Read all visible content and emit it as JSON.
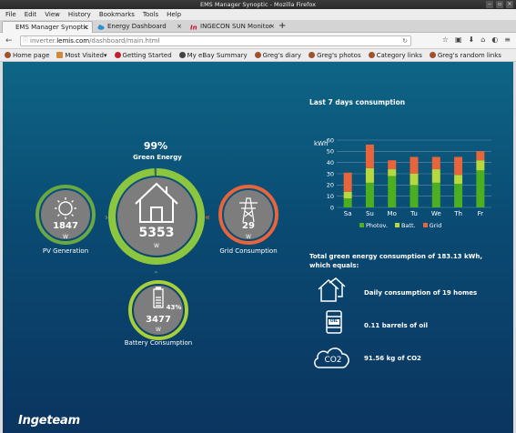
{
  "window": {
    "title": "EMS Manager Synoptic - Mozilla Firefox"
  },
  "menu": [
    "File",
    "Edit",
    "View",
    "History",
    "Bookmarks",
    "Tools",
    "Help"
  ],
  "tabs": [
    {
      "label": "EMS Manager Synoptic",
      "active": true
    },
    {
      "label": "Energy Dashboard",
      "active": false
    },
    {
      "label": "INGECON SUN Monitor",
      "active": false
    }
  ],
  "url": {
    "prefix": "inverter.",
    "domain": "lemis.com",
    "path": "/dashboard/main.html"
  },
  "bookmarks": [
    "Home page",
    "Most Visited",
    "Getting Started",
    "My eBay Summary",
    "Greg's diary",
    "Greg's photos",
    "Category links",
    "Greg's random links"
  ],
  "synoptic": {
    "green_percent": "99%",
    "green_label": "Green Energy",
    "center": {
      "value": "5353",
      "unit": "W"
    },
    "pv": {
      "value": "1847",
      "unit": "W",
      "label": "PV Generation"
    },
    "grid": {
      "value": "29",
      "unit": "W",
      "label": "Grid Consumption"
    },
    "battery": {
      "value": "3477",
      "unit": "W",
      "label": "Battery Consumption",
      "charge": "43%"
    }
  },
  "chart_title": "Last 7 days consumption",
  "chart_data": {
    "type": "bar",
    "stacked": true,
    "ylabel": "kWh",
    "ylim": [
      0,
      60
    ],
    "yticks": [
      0,
      10,
      20,
      30,
      40,
      50,
      60
    ],
    "categories": [
      "Sa",
      "Su",
      "Mo",
      "Tu",
      "We",
      "Th",
      "Fr"
    ],
    "series": [
      {
        "name": "Photov.",
        "color": "#4caf1f",
        "values": [
          8,
          22,
          28,
          20,
          22,
          21,
          33
        ]
      },
      {
        "name": "Batt.",
        "color": "#b8d93e",
        "values": [
          6,
          13,
          6,
          10,
          12,
          8,
          9
        ]
      },
      {
        "name": "Grid",
        "color": "#e8643a",
        "values": [
          17,
          21,
          8,
          15,
          11,
          16,
          8
        ]
      }
    ],
    "grid": true,
    "legend": "bottom"
  },
  "statement": "Total green energy consumption of 183.13 kWh, which equals:",
  "equivalents": [
    {
      "icon": "houses-icon",
      "text": "Daily consumption of 19 homes"
    },
    {
      "icon": "oil-barrel-icon",
      "text": "0.11 barrels of oil",
      "tag": "OIL"
    },
    {
      "icon": "co2-cloud-icon",
      "text": "91.56 kg of CO2",
      "tag": "CO2"
    }
  ],
  "brand": "Ingeteam",
  "colors": {
    "green": "#8cc63f",
    "orange": "#e8643a",
    "bg_top": "#0e6585",
    "bg_bottom": "#0a3560"
  }
}
